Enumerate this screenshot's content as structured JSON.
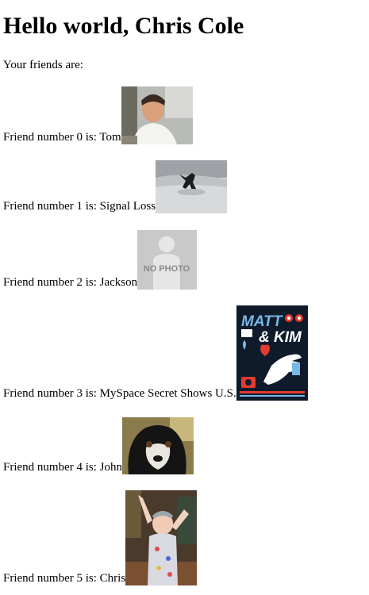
{
  "greeting": "Hello world, Chris Cole",
  "intro": "Your friends are:",
  "friends": [
    {
      "label": "Friend number 0 is: Tom",
      "photo": "tom-photo"
    },
    {
      "label": "Friend number 1 is: Signal Loss",
      "photo": "signal-loss-photo"
    },
    {
      "label": "Friend number 2 is: Jackson",
      "photo": "no-photo-placeholder",
      "placeholder_text": "NO PHOTO"
    },
    {
      "label": "Friend number 3 is: MySpace Secret Shows U.S.",
      "photo": "matt-and-kim-poster",
      "poster_text_1": "MATT",
      "poster_text_2": "& KIM"
    },
    {
      "label": "Friend number 4 is: John",
      "photo": "dog-photo"
    },
    {
      "label": "Friend number 5 is: Chris",
      "photo": "baby-photo"
    }
  ],
  "colors": {
    "poster_bg": "#0f1a2b",
    "poster_red": "#e23b2f",
    "poster_blue": "#78b8e6",
    "placeholder_bg": "#c9c9c9"
  }
}
